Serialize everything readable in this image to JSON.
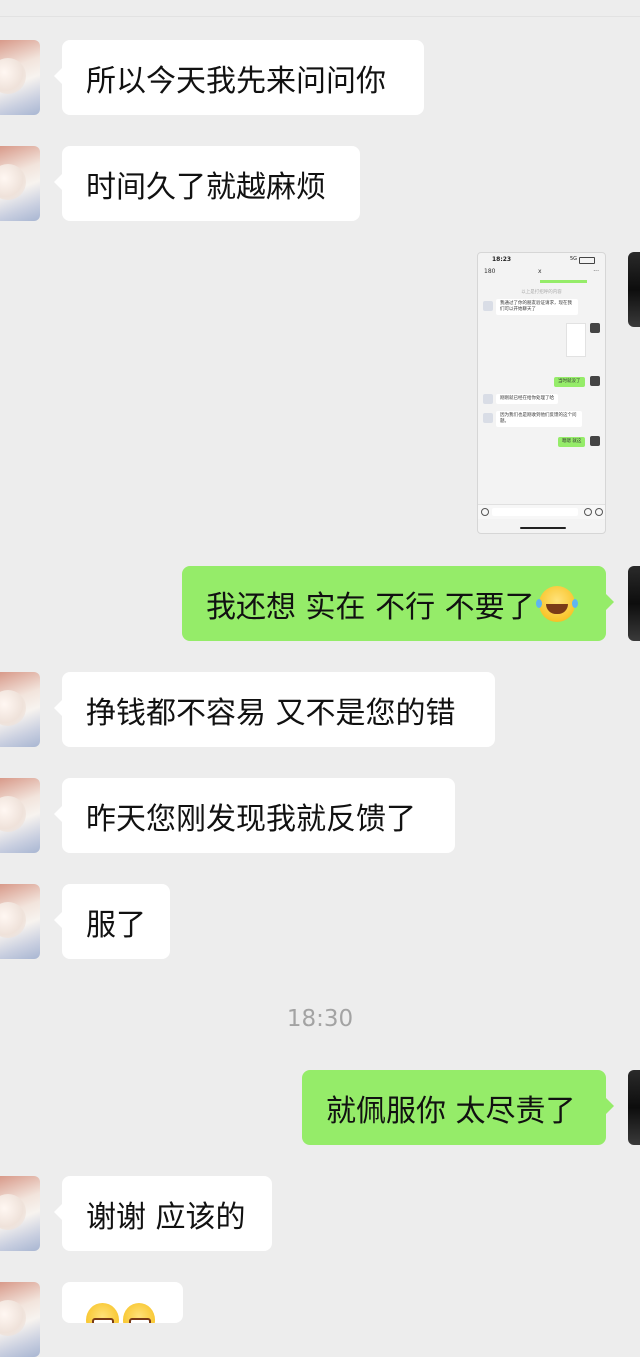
{
  "messages": [
    {
      "side": "in",
      "text": "所以今天我先来问问你"
    },
    {
      "side": "in",
      "text": "时间久了就越麻烦"
    },
    {
      "side": "out",
      "text": "我还想 实在 不行 不要了",
      "emoji": "laughing-tears-emoji"
    },
    {
      "side": "in",
      "text": "挣钱都不容易 又不是您的错"
    },
    {
      "side": "in",
      "text": "昨天您刚发现我就反馈了"
    },
    {
      "side": "in",
      "text": "服了"
    },
    {
      "side": "out",
      "text": "就佩服你 太尽责了"
    },
    {
      "side": "in",
      "text": "谢谢 应该的"
    },
    {
      "side": "in",
      "emoji": "grinning-emoji"
    }
  ],
  "timestamp": "18:30",
  "thumbnail": {
    "status_time": "18:23",
    "status_right": "5G",
    "back_count": "180",
    "title": "x",
    "more": "···",
    "system_note": "以上是打招呼的内容",
    "msg1": "我通过了你的朋友验证请求，现在我们可以开始聊天了",
    "msg2": "当时就没了",
    "msg3": "刚刚就已经在给你处理了哈",
    "msg4": "因为我们也是刚收到他们反馈的这个问题。",
    "msg5": "嗯嗯 就这"
  },
  "colors": {
    "background": "#ededed",
    "bubble_in": "#ffffff",
    "bubble_out": "#95ec69",
    "timestamp": "#a3a3a3"
  }
}
